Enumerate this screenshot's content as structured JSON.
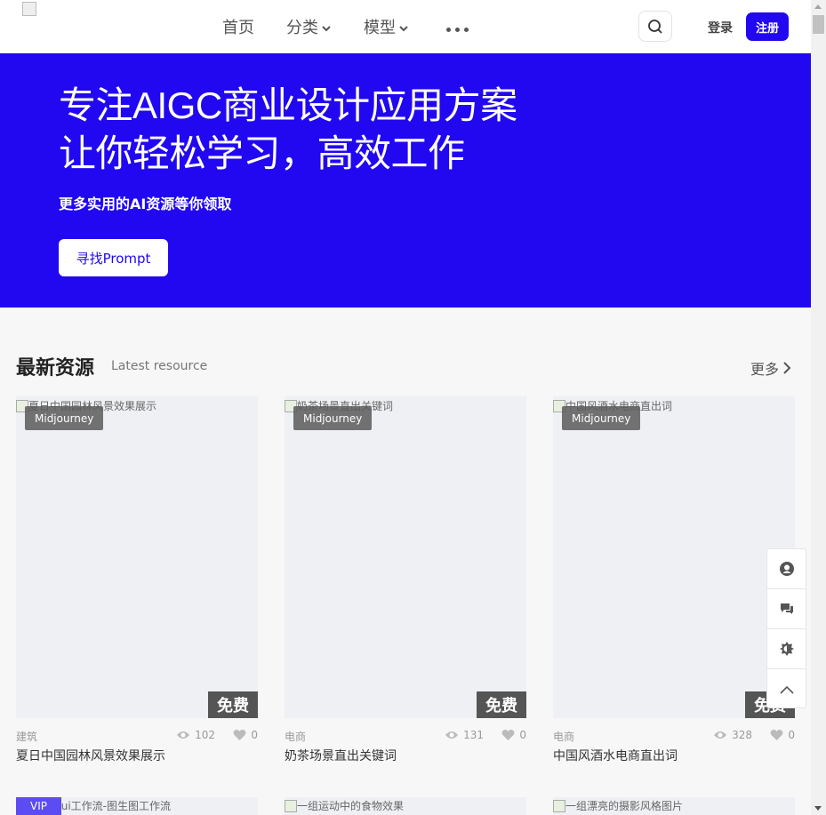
{
  "nav": {
    "items": [
      {
        "label": "首页",
        "has_dropdown": false
      },
      {
        "label": "分类",
        "has_dropdown": true
      },
      {
        "label": "模型",
        "has_dropdown": true
      }
    ],
    "more_icon": "more-dots-icon",
    "search_icon": "search-icon",
    "login_label": "登录",
    "register_label": "注册"
  },
  "hero": {
    "title_line1": "专注AIGC商业设计应用方案",
    "title_line2": "让你轻松学习，高效工作",
    "subtitle": "更多实用的AI资源等你领取",
    "button_label": "寻找Prompt"
  },
  "section": {
    "title": "最新资源",
    "subtitle": "Latest resource",
    "more_label": "更多"
  },
  "cards": [
    {
      "image_alt": "夏日中国园林风景效果展示",
      "tag": "Midjourney",
      "price": "免费",
      "category": "建筑",
      "views": "102",
      "likes": "0",
      "title": "夏日中国园林风景效果展示"
    },
    {
      "image_alt": "奶茶场景直出关键词",
      "tag": "Midjourney",
      "price": "免费",
      "category": "电商",
      "views": "131",
      "likes": "0",
      "title": "奶茶场景直出关键词"
    },
    {
      "image_alt": "中国风酒水电商直出词",
      "tag": "Midjourney",
      "price": "免费",
      "category": "电商",
      "views": "328",
      "likes": "0",
      "title": "中国风酒水电商直出词"
    }
  ],
  "cards_row2": [
    {
      "image_alt": "comfyui工作流-图生图工作流",
      "badge": "VIP"
    },
    {
      "image_alt": "一组运动中的食物效果"
    },
    {
      "image_alt": "一组漂亮的摄影风格图片"
    }
  ],
  "float_tools": [
    "user-icon",
    "chat-icon",
    "theme-icon",
    "back-to-top-icon"
  ],
  "colors": {
    "brand": "#2108f0",
    "background": "#f7f7f8"
  }
}
